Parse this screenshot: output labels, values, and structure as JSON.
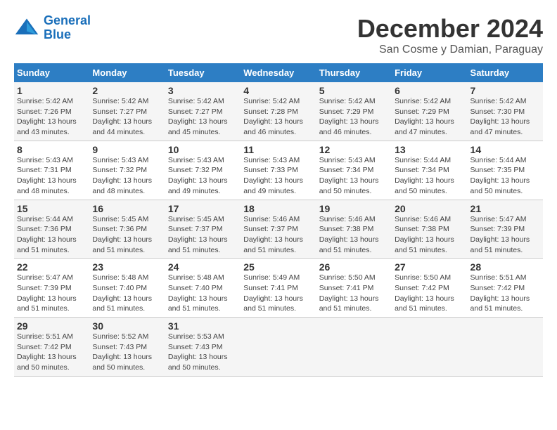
{
  "logo": {
    "text_general": "General",
    "text_blue": "Blue"
  },
  "title": "December 2024",
  "subtitle": "San Cosme y Damian, Paraguay",
  "headers": [
    "Sunday",
    "Monday",
    "Tuesday",
    "Wednesday",
    "Thursday",
    "Friday",
    "Saturday"
  ],
  "weeks": [
    [
      {
        "day": "1",
        "sunrise": "5:42 AM",
        "sunset": "7:26 PM",
        "daylight": "13 hours and 43 minutes."
      },
      {
        "day": "2",
        "sunrise": "5:42 AM",
        "sunset": "7:27 PM",
        "daylight": "13 hours and 44 minutes."
      },
      {
        "day": "3",
        "sunrise": "5:42 AM",
        "sunset": "7:27 PM",
        "daylight": "13 hours and 45 minutes."
      },
      {
        "day": "4",
        "sunrise": "5:42 AM",
        "sunset": "7:28 PM",
        "daylight": "13 hours and 46 minutes."
      },
      {
        "day": "5",
        "sunrise": "5:42 AM",
        "sunset": "7:29 PM",
        "daylight": "13 hours and 46 minutes."
      },
      {
        "day": "6",
        "sunrise": "5:42 AM",
        "sunset": "7:29 PM",
        "daylight": "13 hours and 47 minutes."
      },
      {
        "day": "7",
        "sunrise": "5:42 AM",
        "sunset": "7:30 PM",
        "daylight": "13 hours and 47 minutes."
      }
    ],
    [
      {
        "day": "8",
        "sunrise": "5:43 AM",
        "sunset": "7:31 PM",
        "daylight": "13 hours and 48 minutes."
      },
      {
        "day": "9",
        "sunrise": "5:43 AM",
        "sunset": "7:32 PM",
        "daylight": "13 hours and 48 minutes."
      },
      {
        "day": "10",
        "sunrise": "5:43 AM",
        "sunset": "7:32 PM",
        "daylight": "13 hours and 49 minutes."
      },
      {
        "day": "11",
        "sunrise": "5:43 AM",
        "sunset": "7:33 PM",
        "daylight": "13 hours and 49 minutes."
      },
      {
        "day": "12",
        "sunrise": "5:43 AM",
        "sunset": "7:34 PM",
        "daylight": "13 hours and 50 minutes."
      },
      {
        "day": "13",
        "sunrise": "5:44 AM",
        "sunset": "7:34 PM",
        "daylight": "13 hours and 50 minutes."
      },
      {
        "day": "14",
        "sunrise": "5:44 AM",
        "sunset": "7:35 PM",
        "daylight": "13 hours and 50 minutes."
      }
    ],
    [
      {
        "day": "15",
        "sunrise": "5:44 AM",
        "sunset": "7:36 PM",
        "daylight": "13 hours and 51 minutes."
      },
      {
        "day": "16",
        "sunrise": "5:45 AM",
        "sunset": "7:36 PM",
        "daylight": "13 hours and 51 minutes."
      },
      {
        "day": "17",
        "sunrise": "5:45 AM",
        "sunset": "7:37 PM",
        "daylight": "13 hours and 51 minutes."
      },
      {
        "day": "18",
        "sunrise": "5:46 AM",
        "sunset": "7:37 PM",
        "daylight": "13 hours and 51 minutes."
      },
      {
        "day": "19",
        "sunrise": "5:46 AM",
        "sunset": "7:38 PM",
        "daylight": "13 hours and 51 minutes."
      },
      {
        "day": "20",
        "sunrise": "5:46 AM",
        "sunset": "7:38 PM",
        "daylight": "13 hours and 51 minutes."
      },
      {
        "day": "21",
        "sunrise": "5:47 AM",
        "sunset": "7:39 PM",
        "daylight": "13 hours and 51 minutes."
      }
    ],
    [
      {
        "day": "22",
        "sunrise": "5:47 AM",
        "sunset": "7:39 PM",
        "daylight": "13 hours and 51 minutes."
      },
      {
        "day": "23",
        "sunrise": "5:48 AM",
        "sunset": "7:40 PM",
        "daylight": "13 hours and 51 minutes."
      },
      {
        "day": "24",
        "sunrise": "5:48 AM",
        "sunset": "7:40 PM",
        "daylight": "13 hours and 51 minutes."
      },
      {
        "day": "25",
        "sunrise": "5:49 AM",
        "sunset": "7:41 PM",
        "daylight": "13 hours and 51 minutes."
      },
      {
        "day": "26",
        "sunrise": "5:50 AM",
        "sunset": "7:41 PM",
        "daylight": "13 hours and 51 minutes."
      },
      {
        "day": "27",
        "sunrise": "5:50 AM",
        "sunset": "7:42 PM",
        "daylight": "13 hours and 51 minutes."
      },
      {
        "day": "28",
        "sunrise": "5:51 AM",
        "sunset": "7:42 PM",
        "daylight": "13 hours and 51 minutes."
      }
    ],
    [
      {
        "day": "29",
        "sunrise": "5:51 AM",
        "sunset": "7:42 PM",
        "daylight": "13 hours and 50 minutes."
      },
      {
        "day": "30",
        "sunrise": "5:52 AM",
        "sunset": "7:43 PM",
        "daylight": "13 hours and 50 minutes."
      },
      {
        "day": "31",
        "sunrise": "5:53 AM",
        "sunset": "7:43 PM",
        "daylight": "13 hours and 50 minutes."
      },
      null,
      null,
      null,
      null
    ]
  ]
}
